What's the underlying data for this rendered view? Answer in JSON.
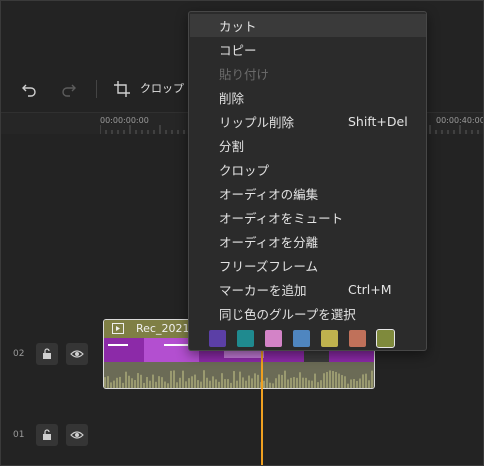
{
  "toolbar": {
    "crop_label": "クロップ",
    "icons": [
      "undo-icon",
      "redo-icon",
      "crop-icon"
    ]
  },
  "ruler": {
    "labels": [
      "00:00:00:00",
      "00:00:40:00"
    ]
  },
  "tracks": [
    {
      "number": "02"
    },
    {
      "number": "01"
    }
  ],
  "clip": {
    "name": "Rec_2021-"
  },
  "context_menu": {
    "items": [
      {
        "label": "カット",
        "shortcut": "",
        "state": "highlighted"
      },
      {
        "label": "コピー",
        "shortcut": "",
        "state": "enabled"
      },
      {
        "label": "貼り付け",
        "shortcut": "",
        "state": "disabled"
      },
      {
        "label": "削除",
        "shortcut": "",
        "state": "enabled"
      },
      {
        "label": "リップル削除",
        "shortcut": "Shift+Del",
        "state": "enabled"
      },
      {
        "label": "分割",
        "shortcut": "",
        "state": "enabled"
      },
      {
        "label": "クロップ",
        "shortcut": "",
        "state": "enabled"
      },
      {
        "label": "オーディオの編集",
        "shortcut": "",
        "state": "enabled"
      },
      {
        "label": "オーディオをミュート",
        "shortcut": "",
        "state": "enabled"
      },
      {
        "label": "オーディオを分離",
        "shortcut": "",
        "state": "enabled"
      },
      {
        "label": "フリーズフレーム",
        "shortcut": "",
        "state": "enabled"
      },
      {
        "label": "マーカーを追加",
        "shortcut": "Ctrl+M",
        "state": "enabled"
      },
      {
        "label": "同じ色のグループを選択",
        "shortcut": "",
        "state": "enabled"
      }
    ],
    "color_swatches": [
      "#5b3fa6",
      "#1f8a8f",
      "#d383c7",
      "#4f86c0",
      "#bfb24e",
      "#c0715a",
      "#7f8a3c"
    ],
    "selected_swatch_index": 6
  },
  "colors": {
    "playhead": "#f0a020",
    "clip_header": "#7f7f45",
    "clip_thumbnail": "#9a2fb2"
  }
}
